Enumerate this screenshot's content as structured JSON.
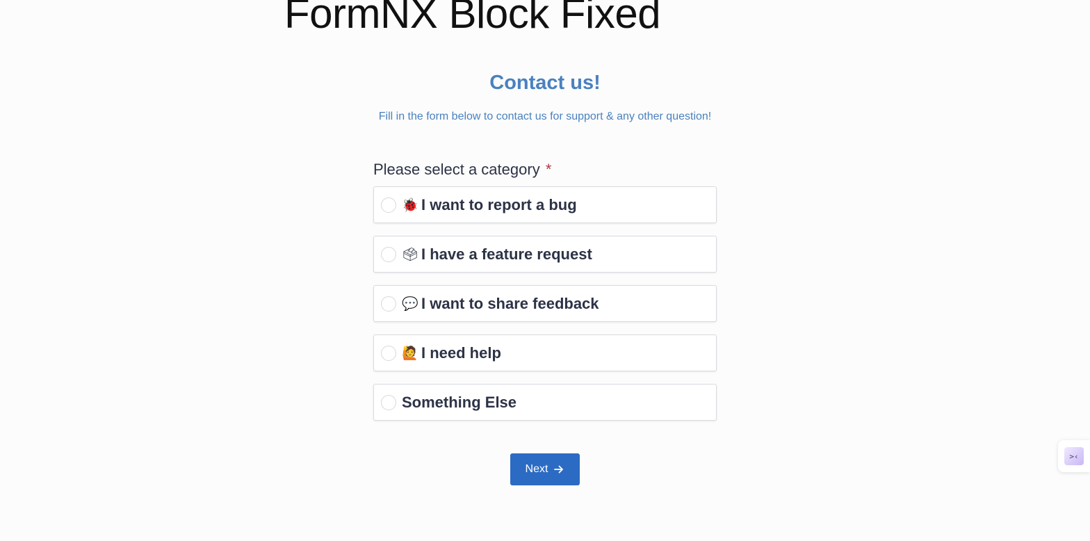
{
  "page": {
    "heading": "FormNX Block Fixed"
  },
  "form": {
    "title": "Contact us!",
    "subtitle": "Fill in the form below to contact us for support & any other question!",
    "question": {
      "label": "Please select a category",
      "required_mark": "*",
      "options": [
        {
          "emoji": "🐞",
          "icon": "ladybug-icon",
          "label": "I want to report a bug"
        },
        {
          "emoji": "🗳",
          "icon": "ballot-box-icon",
          "label": "I have a feature request"
        },
        {
          "emoji": "💬",
          "icon": "speech-bubble-icon",
          "label": "I want to share feedback"
        },
        {
          "emoji": "🙋",
          "icon": "raising-hand-icon",
          "label": "I need help"
        },
        {
          "emoji": "",
          "icon": "",
          "label": "Something Else"
        }
      ]
    },
    "next_button": {
      "label": "Next",
      "icon": "arrow-right-icon"
    }
  },
  "widget": {
    "icon": "chat-widget-icon",
    "glyph": ">‹"
  },
  "colors": {
    "accent": "#2c6bc3",
    "title": "#4a81bf",
    "required": "#b2393f",
    "text": "#2d3346"
  }
}
